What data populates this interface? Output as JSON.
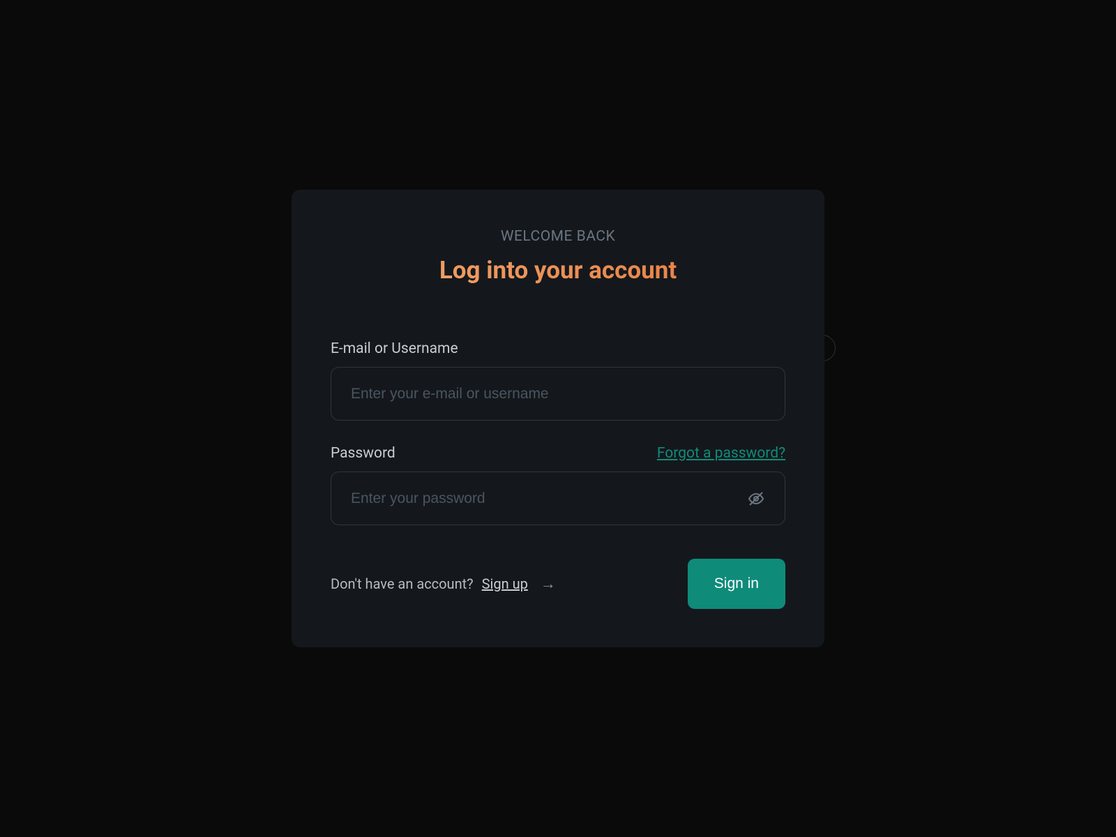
{
  "header": {
    "welcome": "WELCOME BACK",
    "title": "Log into your account"
  },
  "fields": {
    "email": {
      "label": "E-mail or Username",
      "placeholder": "Enter your e-mail or username",
      "value": ""
    },
    "password": {
      "label": "Password",
      "placeholder": "Enter your password",
      "value": "",
      "forgot_link": "Forgot a password?"
    }
  },
  "footer": {
    "signup_prompt": "Don't have an account?",
    "signup_link": "Sign up",
    "signin_button": "Sign in"
  },
  "colors": {
    "background": "#0a0a0a",
    "card": "#14181c",
    "accent": "#0f8b7a",
    "title_gradient_start": "#f0a770",
    "title_gradient_end": "#e87a3c"
  }
}
